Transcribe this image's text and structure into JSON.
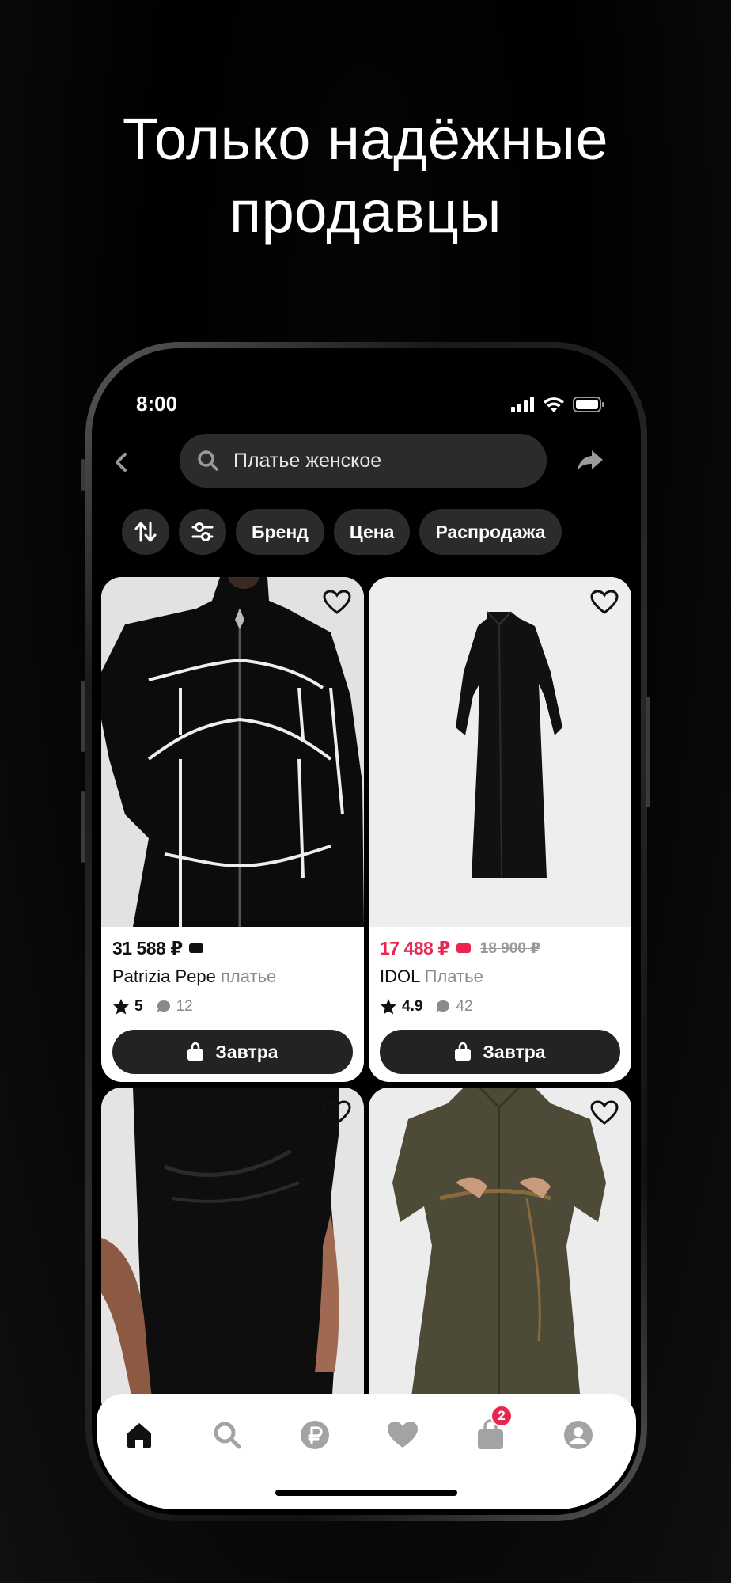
{
  "headline": {
    "line1": "Только надёжные",
    "line2": "продавцы"
  },
  "status_bar": {
    "time": "8:00"
  },
  "search": {
    "query": "Платье женское"
  },
  "filters": {
    "brand": "Бренд",
    "price": "Цена",
    "sale": "Распродажа"
  },
  "products": [
    {
      "price": "31 588 ₽",
      "old_price": "",
      "brand": "Patrizia Pepe",
      "category": "платье",
      "rating": "5",
      "reviews": "12",
      "delivery": "Завтра"
    },
    {
      "price": "17 488 ₽",
      "old_price": "18 900 ₽",
      "brand": "IDOL",
      "category": "Платье",
      "rating": "4.9",
      "reviews": "42",
      "delivery": "Завтра"
    }
  ],
  "tabbar": {
    "cart_badge": "2"
  },
  "colors": {
    "accent": "#e8264f",
    "dark_button": "#232323",
    "chip_bg": "#2b2b2b"
  }
}
